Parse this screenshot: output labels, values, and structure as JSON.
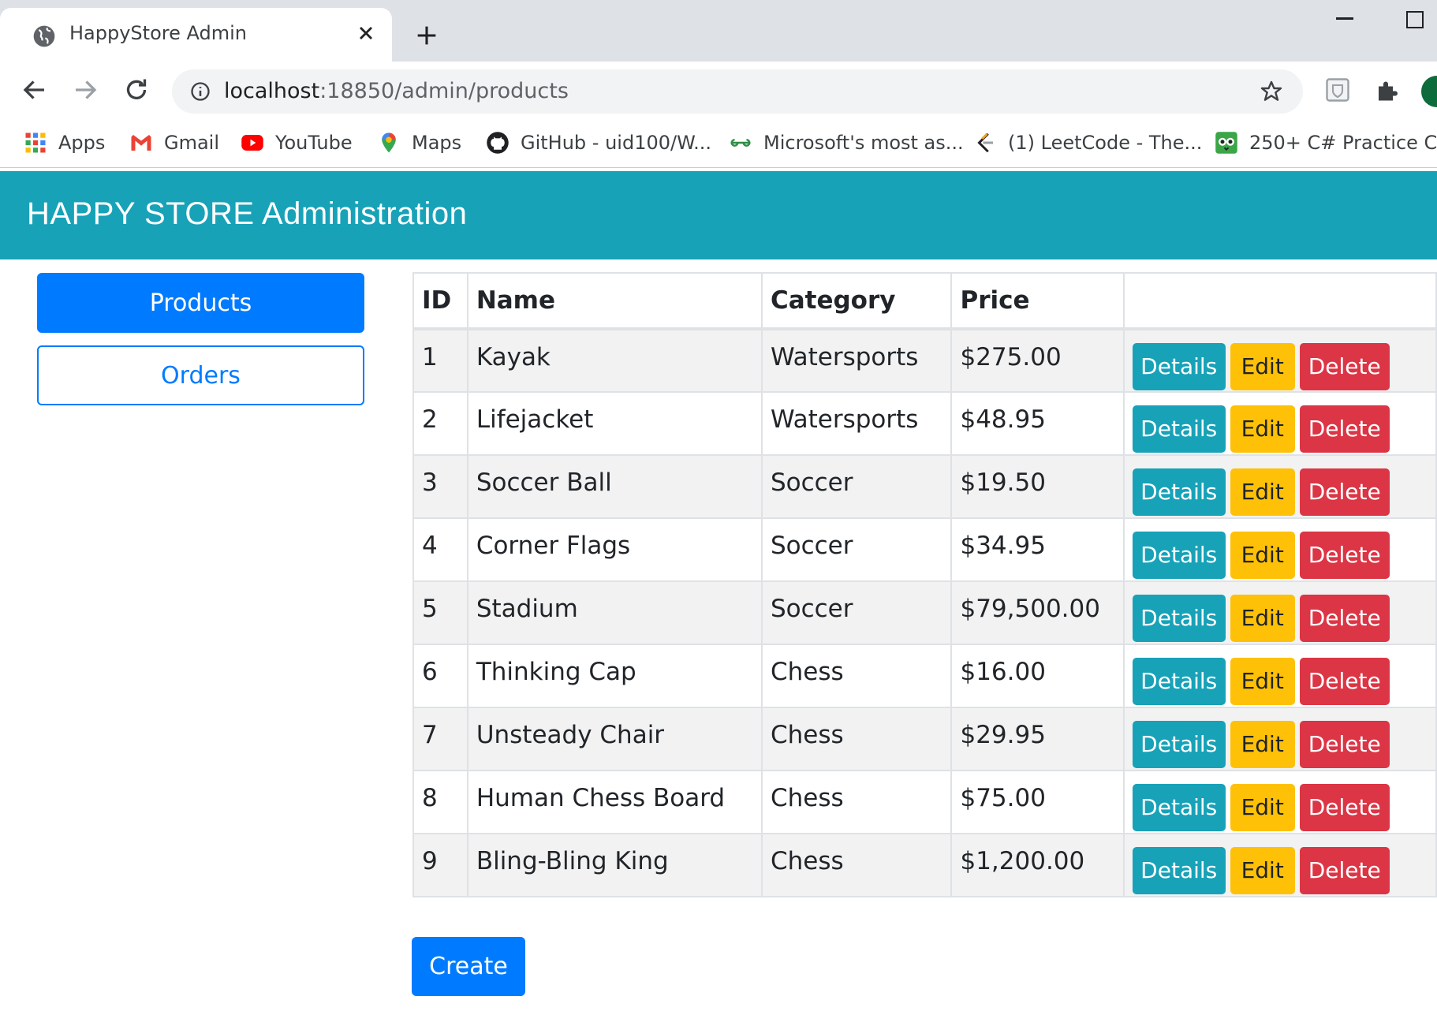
{
  "browser": {
    "tab_title": "HappyStore Admin",
    "url_host": "localhost",
    "url_rest": ":18850/admin/products",
    "bookmarks": [
      {
        "label": "Apps",
        "icon": "apps-grid-icon"
      },
      {
        "label": "Gmail",
        "icon": "gmail-icon"
      },
      {
        "label": "YouTube",
        "icon": "youtube-icon"
      },
      {
        "label": "Maps",
        "icon": "maps-pin-icon"
      },
      {
        "label": "GitHub - uid100/W...",
        "icon": "github-icon"
      },
      {
        "label": "Microsoft's most as...",
        "icon": "geeksforgeeks-icon"
      },
      {
        "label": "(1) LeetCode - The...",
        "icon": "leetcode-icon"
      },
      {
        "label": "250+ C# Practice C...",
        "icon": "owl-icon"
      }
    ]
  },
  "header": {
    "title": "HAPPY STORE Administration"
  },
  "sidebar": {
    "products_label": "Products",
    "orders_label": "Orders"
  },
  "table": {
    "headers": {
      "id": "ID",
      "name": "Name",
      "category": "Category",
      "price": "Price"
    },
    "action_labels": {
      "details": "Details",
      "edit": "Edit",
      "delete": "Delete"
    },
    "rows": [
      {
        "id": "1",
        "name": "Kayak",
        "category": "Watersports",
        "price": "$275.00"
      },
      {
        "id": "2",
        "name": "Lifejacket",
        "category": "Watersports",
        "price": "$48.95"
      },
      {
        "id": "3",
        "name": "Soccer Ball",
        "category": "Soccer",
        "price": "$19.50"
      },
      {
        "id": "4",
        "name": "Corner Flags",
        "category": "Soccer",
        "price": "$34.95"
      },
      {
        "id": "5",
        "name": "Stadium",
        "category": "Soccer",
        "price": "$79,500.00"
      },
      {
        "id": "6",
        "name": "Thinking Cap",
        "category": "Chess",
        "price": "$16.00"
      },
      {
        "id": "7",
        "name": "Unsteady Chair",
        "category": "Chess",
        "price": "$29.95"
      },
      {
        "id": "8",
        "name": "Human Chess Board",
        "category": "Chess",
        "price": "$75.00"
      },
      {
        "id": "9",
        "name": "Bling-Bling King",
        "category": "Chess",
        "price": "$1,200.00"
      }
    ]
  },
  "create_label": "Create",
  "colors": {
    "header_bg": "#17a2b8",
    "primary": "#007bff",
    "info": "#17a2b8",
    "warning": "#ffc107",
    "danger": "#dc3545"
  }
}
